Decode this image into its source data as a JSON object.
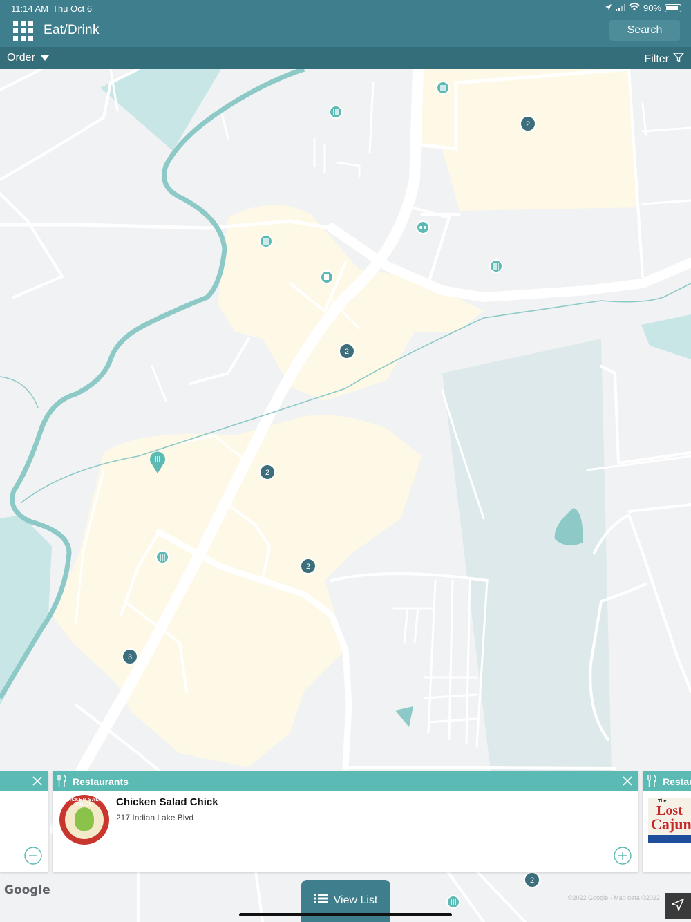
{
  "status_bar": {
    "time": "11:14 AM",
    "date": "Thu Oct 6",
    "battery": "90%"
  },
  "header": {
    "title": "Eat/Drink",
    "search_label": "Search"
  },
  "subbar": {
    "order_label": "Order",
    "filter_label": "Filter"
  },
  "map": {
    "clusters": [
      "2",
      "2",
      "2",
      "2",
      "3",
      "2"
    ],
    "attribution": "Google",
    "map_data": "©2022 Google · Map data ©2022"
  },
  "cards": {
    "main": {
      "category": "Restaurants",
      "name": "Chicken Salad Chick",
      "address": "217 Indian Lake Blvd",
      "logo_text": "CHICKEN SALAD CHICK"
    },
    "right": {
      "category": "Restau",
      "logo_line1": "The",
      "logo_line2": "Lost",
      "logo_line3": "Cajun"
    }
  },
  "view_list_label": "View List",
  "colors": {
    "header": "#3f7f8d",
    "subbar": "#356e7b",
    "accent": "#5bbab3",
    "park": "#fdf9e6",
    "water": "#c9e6e7"
  }
}
